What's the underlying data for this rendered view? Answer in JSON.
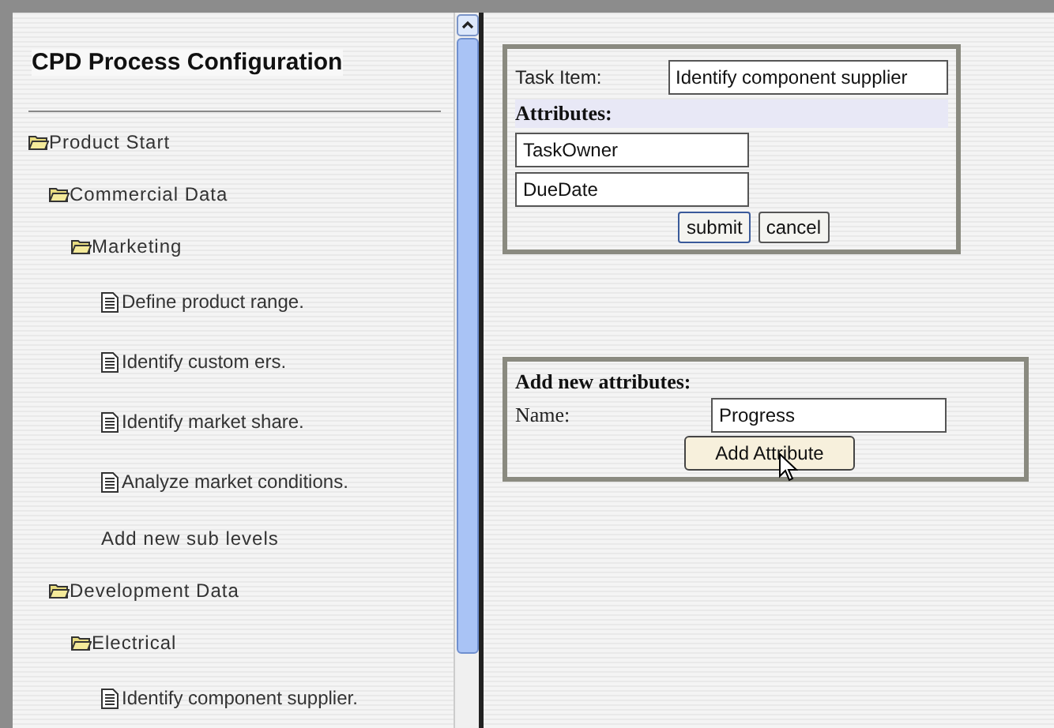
{
  "sidebar": {
    "title": "CPD Process Configuration",
    "tree": [
      {
        "kind": "folder",
        "label": "Product Start",
        "children": [
          {
            "kind": "folder",
            "label": "Commercial Data",
            "children": [
              {
                "kind": "folder",
                "label": "Marketing",
                "children": [
                  {
                    "kind": "document",
                    "label": "Define product range."
                  },
                  {
                    "kind": "document",
                    "label": "Identify custom ers."
                  },
                  {
                    "kind": "document",
                    "label": "Identify market share."
                  },
                  {
                    "kind": "document",
                    "label": "Analyze market conditions."
                  },
                  {
                    "kind": "action",
                    "label": "Add new sub levels"
                  }
                ]
              }
            ]
          },
          {
            "kind": "folder",
            "label": "Development Data",
            "children": [
              {
                "kind": "folder",
                "label": "Electrical",
                "children": [
                  {
                    "kind": "document",
                    "label": "Identify component supplier."
                  }
                ]
              }
            ]
          }
        ]
      }
    ]
  },
  "task_form": {
    "task_label": "Task Item:",
    "task_value": "Identify component supplier",
    "attributes_heading": "Attributes:",
    "attributes": [
      "TaskOwner",
      "DueDate"
    ],
    "buttons": [
      "submit",
      "cancel"
    ]
  },
  "add_form": {
    "heading": "Add new attributes:",
    "name_label": "Name:",
    "name_value": "Progress",
    "button": "Add Attribute"
  }
}
